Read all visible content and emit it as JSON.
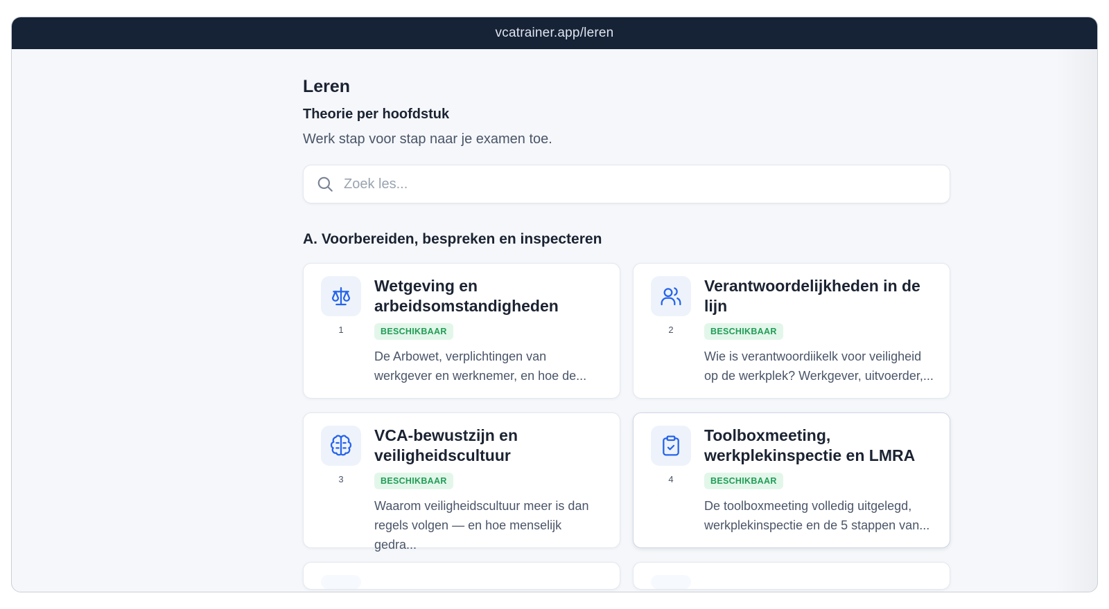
{
  "browser": {
    "url": "vcatrainer.app/leren"
  },
  "page": {
    "title": "Leren",
    "subtitle": "Theorie per hoofdstuk",
    "description": "Werk stap voor stap naar je examen toe."
  },
  "search": {
    "placeholder": "Zoek les...",
    "value": ""
  },
  "section": {
    "title": "A. Voorbereiden, bespreken en inspecteren"
  },
  "accent_color": "#2563eb",
  "badge_color": "#1f9d55",
  "cards": [
    {
      "number": "1",
      "icon": "scale-icon",
      "title": "Wetgeving en arbeidsomstandigheden",
      "badge": "BESCHIKBAAR",
      "description": "De Arbowet, verplichtingen van werkgever en werknemer, en hoe de..."
    },
    {
      "number": "2",
      "icon": "users-icon",
      "title": "Verantwoordelijkheden in de lijn",
      "badge": "BESCHIKBAAR",
      "description": "Wie is verantwoordiikelk voor veiligheid op de werkplek? Werkgever, uitvoerder,..."
    },
    {
      "number": "3",
      "icon": "brain-icon",
      "title": "VCA-bewustzijn en veiligheidscultuur",
      "badge": "BESCHIKBAAR",
      "description": "Waarom veiligheidscultuur meer is dan regels volgen — en hoe menselijk gedra..."
    },
    {
      "number": "4",
      "icon": "clipboard-check-icon",
      "title": "Toolboxmeeting, werkplekinspectie en LMRA",
      "badge": "BESCHIKBAAR",
      "description": "De toolboxmeeting volledig uitgelegd, werkplekinspectie en de 5 stappen van..."
    }
  ]
}
